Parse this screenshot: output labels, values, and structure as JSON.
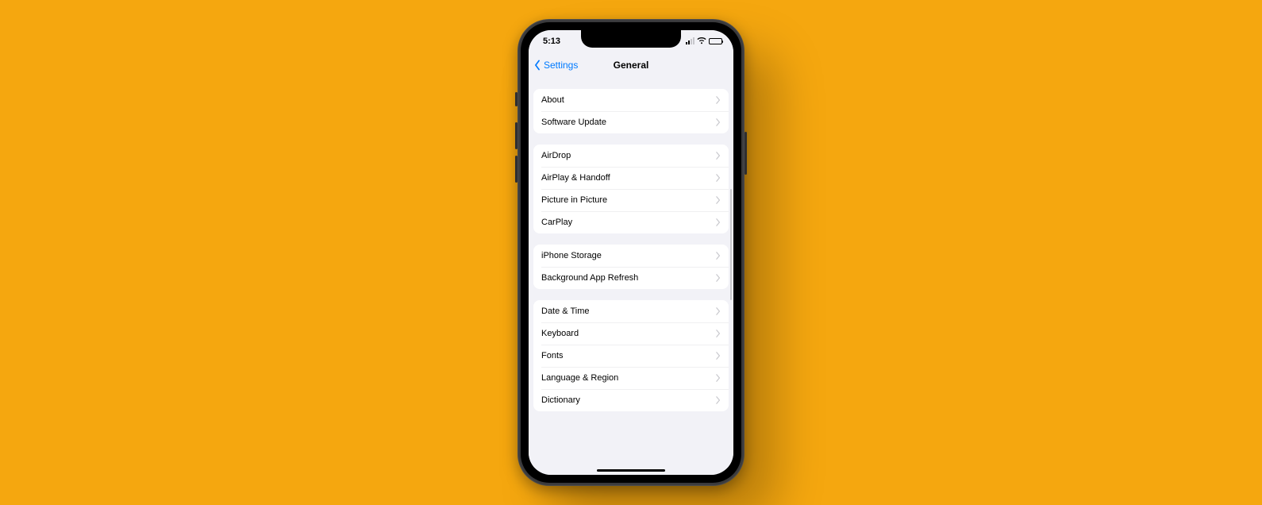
{
  "status": {
    "time": "5:13"
  },
  "nav": {
    "back_label": "Settings",
    "title": "General"
  },
  "groups": [
    {
      "id": "group-info",
      "items": [
        {
          "key": "about",
          "label": "About"
        },
        {
          "key": "software-update",
          "label": "Software Update"
        }
      ]
    },
    {
      "id": "group-connect",
      "items": [
        {
          "key": "airdrop",
          "label": "AirDrop"
        },
        {
          "key": "airplay-handoff",
          "label": "AirPlay & Handoff"
        },
        {
          "key": "picture-in-picture",
          "label": "Picture in Picture"
        },
        {
          "key": "carplay",
          "label": "CarPlay"
        }
      ]
    },
    {
      "id": "group-storage",
      "items": [
        {
          "key": "iphone-storage",
          "label": "iPhone Storage"
        },
        {
          "key": "background-app-refresh",
          "label": "Background App Refresh"
        }
      ]
    },
    {
      "id": "group-locale",
      "items": [
        {
          "key": "date-time",
          "label": "Date & Time"
        },
        {
          "key": "keyboard",
          "label": "Keyboard"
        },
        {
          "key": "fonts",
          "label": "Fonts"
        },
        {
          "key": "language-region",
          "label": "Language & Region"
        },
        {
          "key": "dictionary",
          "label": "Dictionary"
        }
      ]
    }
  ]
}
